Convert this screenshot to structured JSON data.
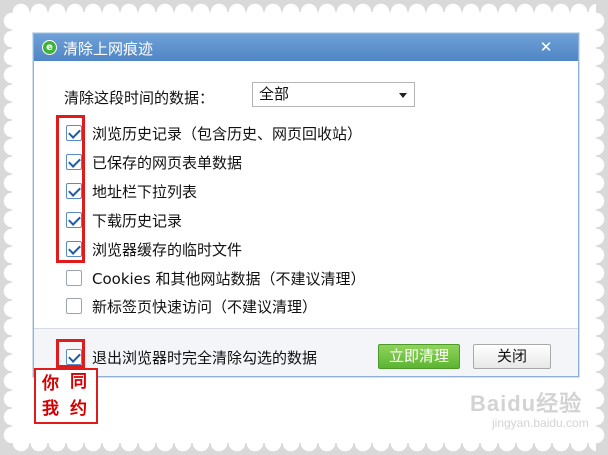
{
  "dialog": {
    "title": "清除上网痕迹",
    "close_glyph": "✕",
    "range_label": "清除这段时间的数据：",
    "range_value": "全部",
    "options": [
      {
        "label": "浏览历史记录（包含历史、网页回收站）",
        "checked": true
      },
      {
        "label": "已保存的网页表单数据",
        "checked": true
      },
      {
        "label": "地址栏下拉列表",
        "checked": true
      },
      {
        "label": "下载历史记录",
        "checked": true
      },
      {
        "label": "浏览器缓存的临时文件",
        "checked": true
      },
      {
        "label": "Cookies 和其他网站数据（不建议清理）",
        "checked": false
      },
      {
        "label": "新标签页快速访问（不建议清理）",
        "checked": false
      }
    ],
    "exit_clear_label": "退出浏览器时完全清除勾选的数据",
    "exit_clear_checked": true,
    "clean_now_button": "立即清理",
    "close_button": "关闭"
  },
  "stamp": {
    "chars": [
      "你",
      "同",
      "我",
      "约"
    ]
  },
  "watermark": {
    "text": "Baidu经验",
    "sub": "jingyan.baidu.com"
  },
  "colors": {
    "highlight_red": "#e01b1b",
    "titlebar_blue": "#4f86c4",
    "clean_green": "#5cb532"
  }
}
